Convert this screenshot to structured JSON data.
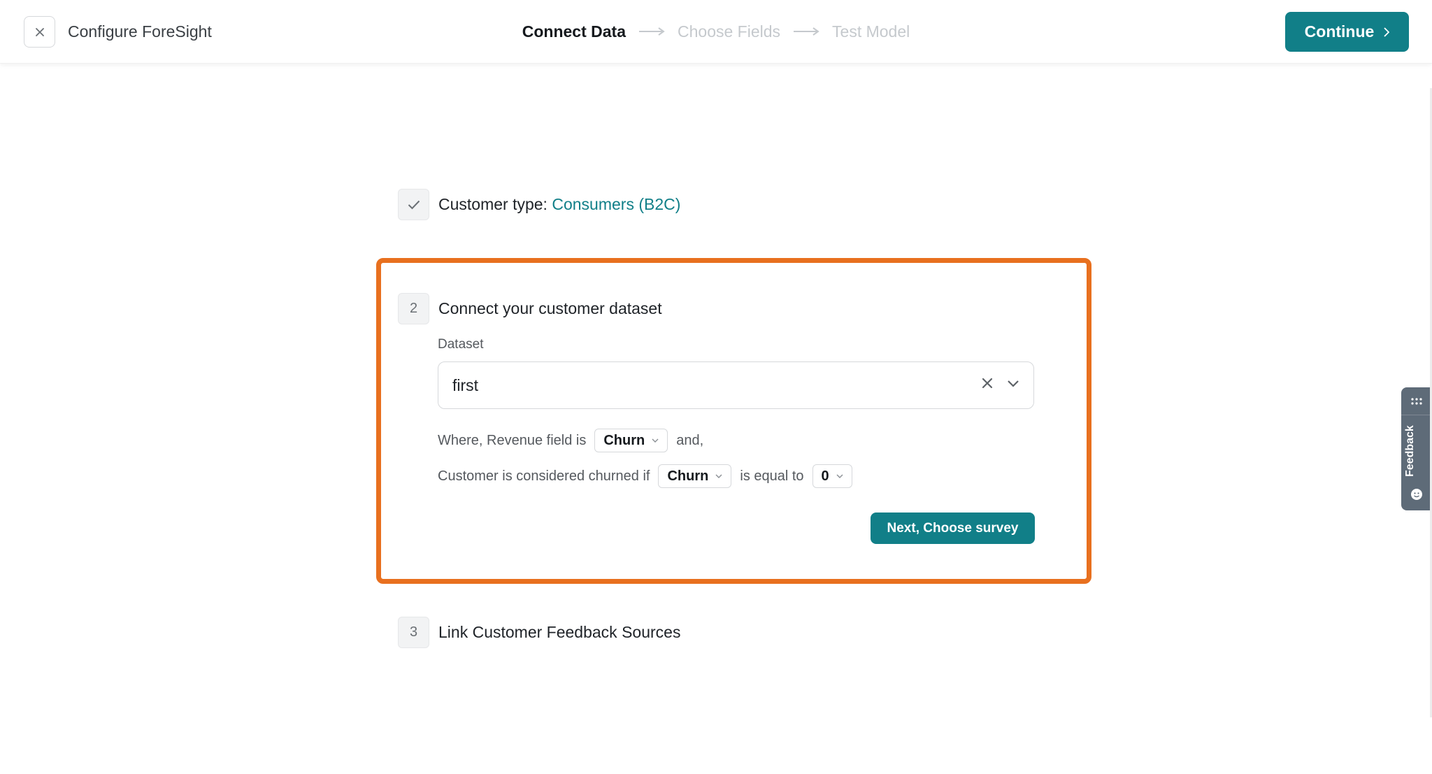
{
  "header": {
    "close_icon": "close-icon",
    "title": "Configure ForeSight",
    "steps": [
      {
        "label": "Connect Data",
        "state": "active"
      },
      {
        "label": "Choose Fields",
        "state": "inactive"
      },
      {
        "label": "Test Model",
        "state": "inactive"
      }
    ],
    "continue_label": "Continue"
  },
  "step1": {
    "icon": "check-icon",
    "label": "Customer type:",
    "value": "Consumers (B2C)"
  },
  "step2": {
    "number": "2",
    "title": "Connect your customer dataset",
    "dataset_label": "Dataset",
    "dataset_value": "first",
    "revenue_prefix": "Where, Revenue field is",
    "revenue_field": "Churn",
    "revenue_suffix": "and,",
    "churn_prefix": "Customer is considered churned if",
    "churn_field": "Churn",
    "churn_middle": "is equal to",
    "churn_value": "0",
    "next_label": "Next, Choose survey"
  },
  "step3": {
    "number": "3",
    "title": "Link Customer Feedback Sources"
  },
  "feedback": {
    "label": "Feedback"
  },
  "colors": {
    "accent": "#117f88",
    "highlight": "#e8701f",
    "feedback_tab": "#5e6b78"
  }
}
